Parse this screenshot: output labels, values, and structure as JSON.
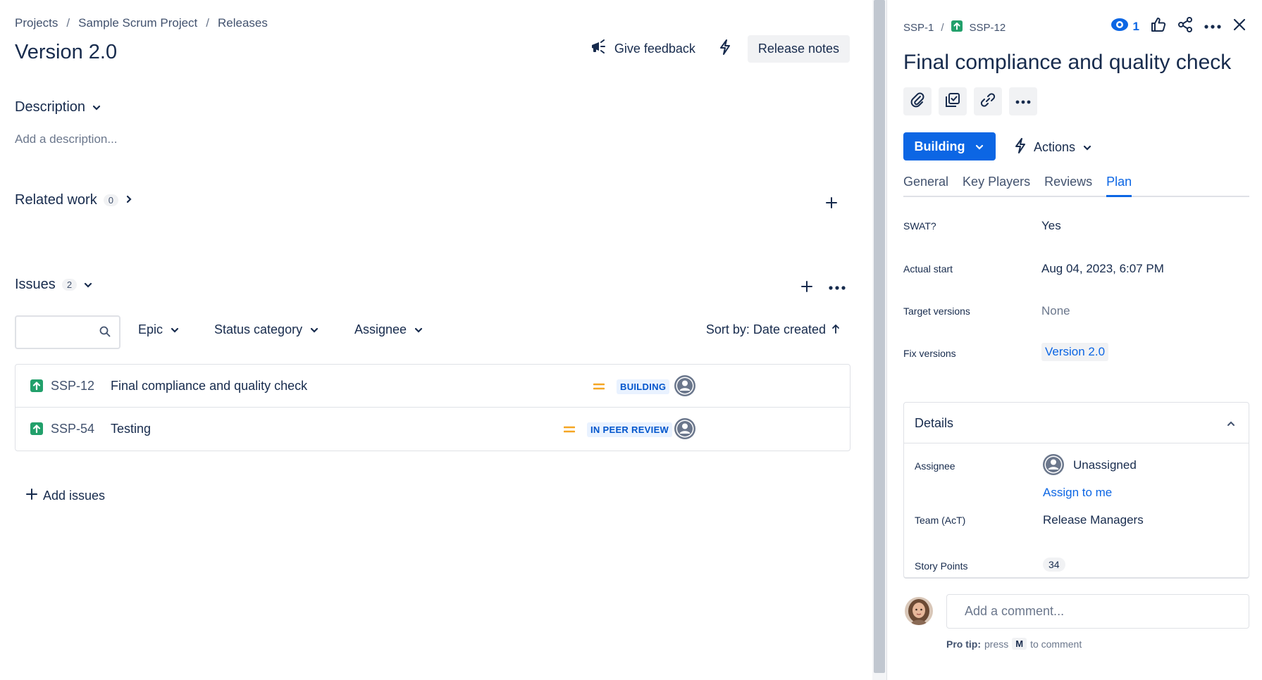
{
  "breadcrumb": {
    "items": [
      "Projects",
      "Sample Scrum Project",
      "Releases"
    ],
    "separator": "/"
  },
  "page": {
    "title": "Version 2.0",
    "feedback_label": "Give feedback",
    "release_notes_label": "Release notes"
  },
  "description": {
    "heading": "Description",
    "placeholder": "Add a description..."
  },
  "related_work": {
    "heading": "Related work",
    "count": "0"
  },
  "issues": {
    "heading": "Issues",
    "count": "2",
    "filters": {
      "search_placeholder": "",
      "epic": "Epic",
      "status_category": "Status category",
      "assignee": "Assignee",
      "sort": "Sort by: Date created"
    },
    "rows": [
      {
        "key": "SSP-12",
        "summary": "Final compliance and quality check",
        "priority": "medium",
        "status": "BUILDING"
      },
      {
        "key": "SSP-54",
        "summary": "Testing",
        "priority": "medium",
        "status": "IN PEER REVIEW"
      }
    ],
    "add_label": "Add issues"
  },
  "panel": {
    "crumb": {
      "parent": "SSP-1",
      "separator": "/",
      "current": "SSP-12"
    },
    "watchers": "1",
    "title": "Final compliance and quality check",
    "status_button": "Building",
    "actions_label": "Actions",
    "tabs": [
      "General",
      "Key Players",
      "Reviews",
      "Plan"
    ],
    "active_tab": "Plan",
    "fields": {
      "swat_label": "SWAT?",
      "swat_value": "Yes",
      "actual_start_label": "Actual start",
      "actual_start_value": "Aug 04, 2023, 6:07 PM",
      "target_versions_label": "Target versions",
      "target_versions_value": "None",
      "fix_versions_label": "Fix versions",
      "fix_versions_value": "Version 2.0"
    },
    "details": {
      "heading": "Details",
      "assignee_label": "Assignee",
      "assignee_value": "Unassigned",
      "assign_to_me": "Assign to me",
      "team_label": "Team (AcT)",
      "team_value": "Release Managers",
      "story_points_label": "Story Points",
      "story_points_value": "34"
    },
    "comment": {
      "placeholder": "Add a comment...",
      "tip_bold": "Pro tip:",
      "tip_pre": "press",
      "tip_key": "M",
      "tip_post": "to comment"
    }
  },
  "colors": {
    "brand_blue": "#0c66e4",
    "status_bg": "#e9f2ff",
    "status_text": "#0055cc",
    "story_green": "#22a06b",
    "priority_orange": "#f5a623",
    "text_primary": "#172b4d"
  },
  "icons": {
    "feedback": "megaphone-icon",
    "automation": "lightning-bolt-icon",
    "search": "search-icon",
    "story": "story-arrow-up-icon",
    "priority": "priority-medium-icon",
    "watch": "eye-icon",
    "like": "thumbs-up-icon",
    "share": "share-icon",
    "more": "ellipsis-icon",
    "close": "close-icon",
    "attach": "paperclip-icon",
    "child": "checkbox-child-icon",
    "link": "link-icon"
  }
}
